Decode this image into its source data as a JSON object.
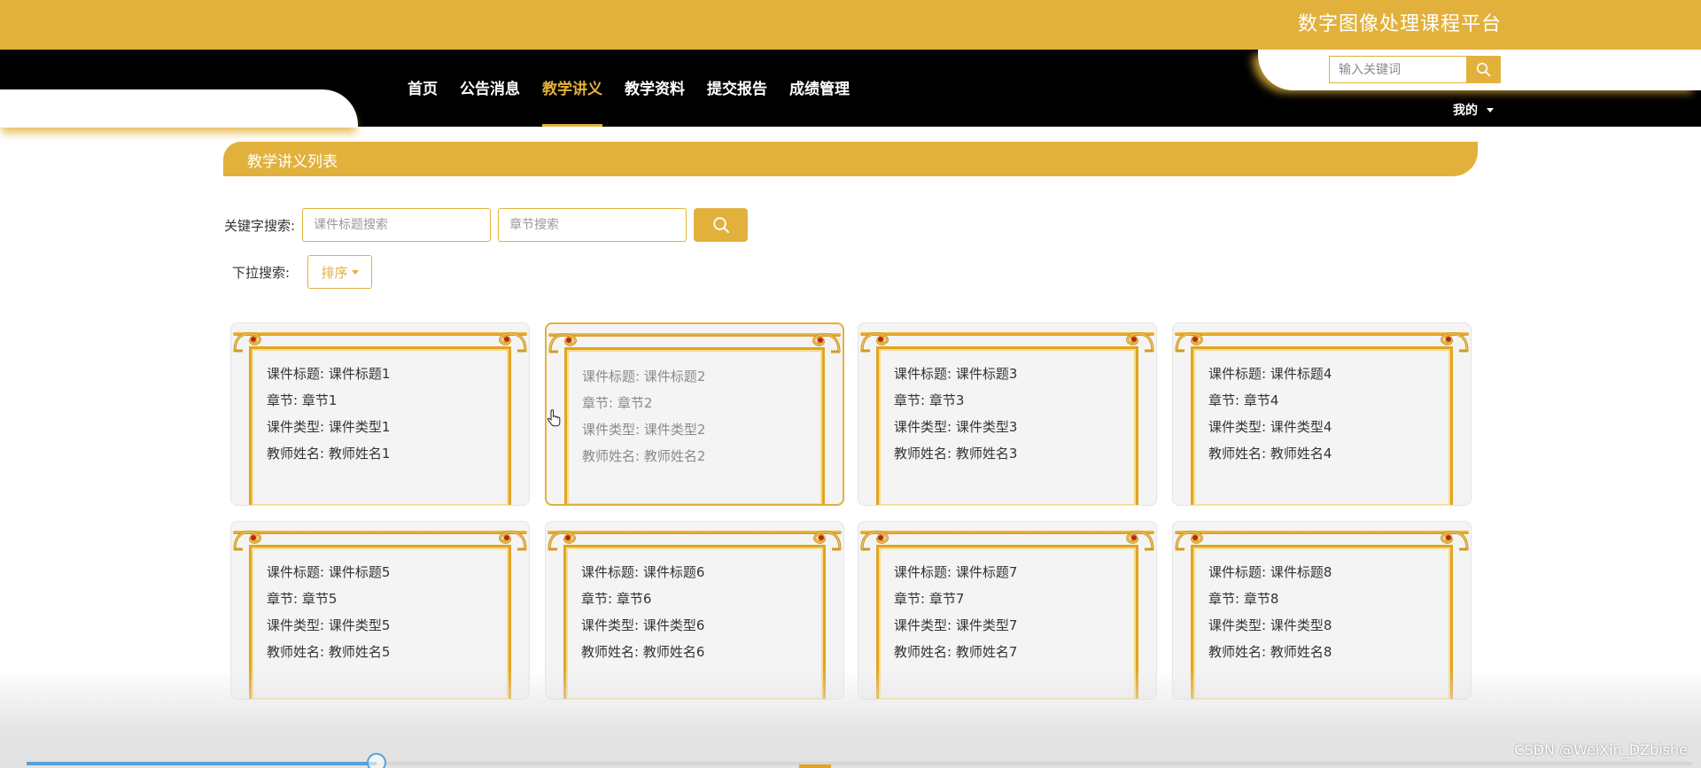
{
  "site": {
    "title": "数字图像处理课程平台"
  },
  "nav": {
    "items": [
      "首页",
      "公告消息",
      "教学讲义",
      "教学资料",
      "提交报告",
      "成绩管理"
    ],
    "active_index": 2
  },
  "header_search": {
    "placeholder": "输入关键词"
  },
  "user_menu": {
    "label": "我的"
  },
  "section": {
    "title": "教学讲义列表"
  },
  "filters": {
    "keyword_label": "关键字搜索:",
    "title_placeholder": "课件标题搜索",
    "chapter_placeholder": "章节搜索",
    "dropdown_label": "下拉搜索:",
    "sort_label": "排序"
  },
  "cards": [
    {
      "lines": [
        "课件标题: 课件标题1",
        "章节: 章节1",
        "课件类型: 课件类型1",
        "教师姓名: 教师姓名1"
      ]
    },
    {
      "lines": [
        "课件标题: 课件标题2",
        "章节: 章节2",
        "课件类型: 课件类型2",
        "教师姓名: 教师姓名2"
      ],
      "selected": true
    },
    {
      "lines": [
        "课件标题: 课件标题3",
        "章节: 章节3",
        "课件类型: 课件类型3",
        "教师姓名: 教师姓名3"
      ]
    },
    {
      "lines": [
        "课件标题: 课件标题4",
        "章节: 章节4",
        "课件类型: 课件类型4",
        "教师姓名: 教师姓名4"
      ]
    },
    {
      "lines": [
        "课件标题: 课件标题5",
        "章节: 章节5",
        "课件类型: 课件类型5",
        "教师姓名: 教师姓名5"
      ]
    },
    {
      "lines": [
        "课件标题: 课件标题6",
        "章节: 章节6",
        "课件类型: 课件类型6",
        "教师姓名: 教师姓名6"
      ]
    },
    {
      "lines": [
        "课件标题: 课件标题7",
        "章节: 章节7",
        "课件类型: 课件类型7",
        "教师姓名: 教师姓名7"
      ]
    },
    {
      "lines": [
        "课件标题: 课件标题8",
        "章节: 章节8",
        "课件类型: 课件类型8",
        "教师姓名: 教师姓名8"
      ]
    }
  ],
  "video_progress": {
    "fraction": 0.21
  },
  "watermark": "CSDN @WeiXin_DZbishe",
  "colors": {
    "accent": "#e2b13c",
    "nav_background": "#000000",
    "frame_gold": "#e2a520",
    "progress_blue": "#5aa0d8"
  }
}
